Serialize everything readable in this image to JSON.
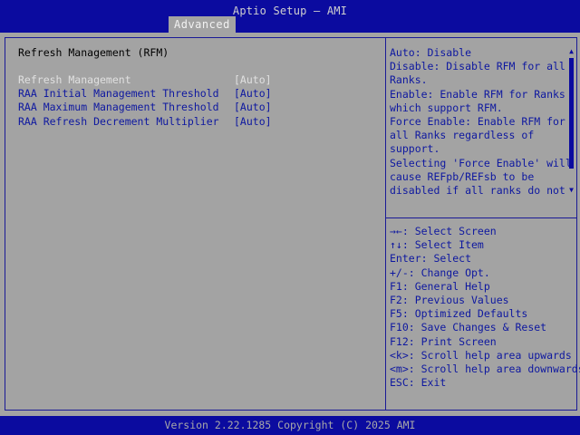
{
  "header": {
    "title": "Aptio Setup – AMI",
    "active_tab": "Advanced"
  },
  "section_title": "Refresh Management (RFM)",
  "settings": [
    {
      "label": "Refresh Management",
      "value": "[Auto]",
      "selected": true
    },
    {
      "label": "RAA Initial Management Threshold",
      "value": "[Auto]"
    },
    {
      "label": "RAA Maximum Management Threshold",
      "value": "[Auto]"
    },
    {
      "label": "RAA Refresh Decrement Multiplier",
      "value": "[Auto]"
    }
  ],
  "help_text": [
    "Auto: Disable",
    "Disable: Disable RFM for all",
    "Ranks.",
    "Enable: Enable RFM for Ranks",
    "which support RFM.",
    "Force Enable: Enable RFM for",
    "all Ranks regardless of",
    "support.",
    "Selecting 'Force Enable' will",
    "cause REFpb/REFsb to be",
    "disabled if all ranks do not"
  ],
  "key_help": [
    "→←: Select Screen",
    "↑↓: Select Item",
    "Enter: Select",
    "+/-: Change Opt.",
    "F1: General Help",
    "F2: Previous Values",
    "F5: Optimized Defaults",
    "F10: Save Changes & Reset",
    "F12: Print Screen",
    "<k>: Scroll help area upwards",
    "<m>: Scroll help area downwards",
    "ESC: Exit"
  ],
  "footer": "Version 2.22.1285 Copyright (C) 2025 AMI",
  "colors": {
    "bar": "#0b0b9f",
    "background": "#a3a3a3",
    "text": "#0e18a0",
    "highlight": "#e0e0e0"
  }
}
